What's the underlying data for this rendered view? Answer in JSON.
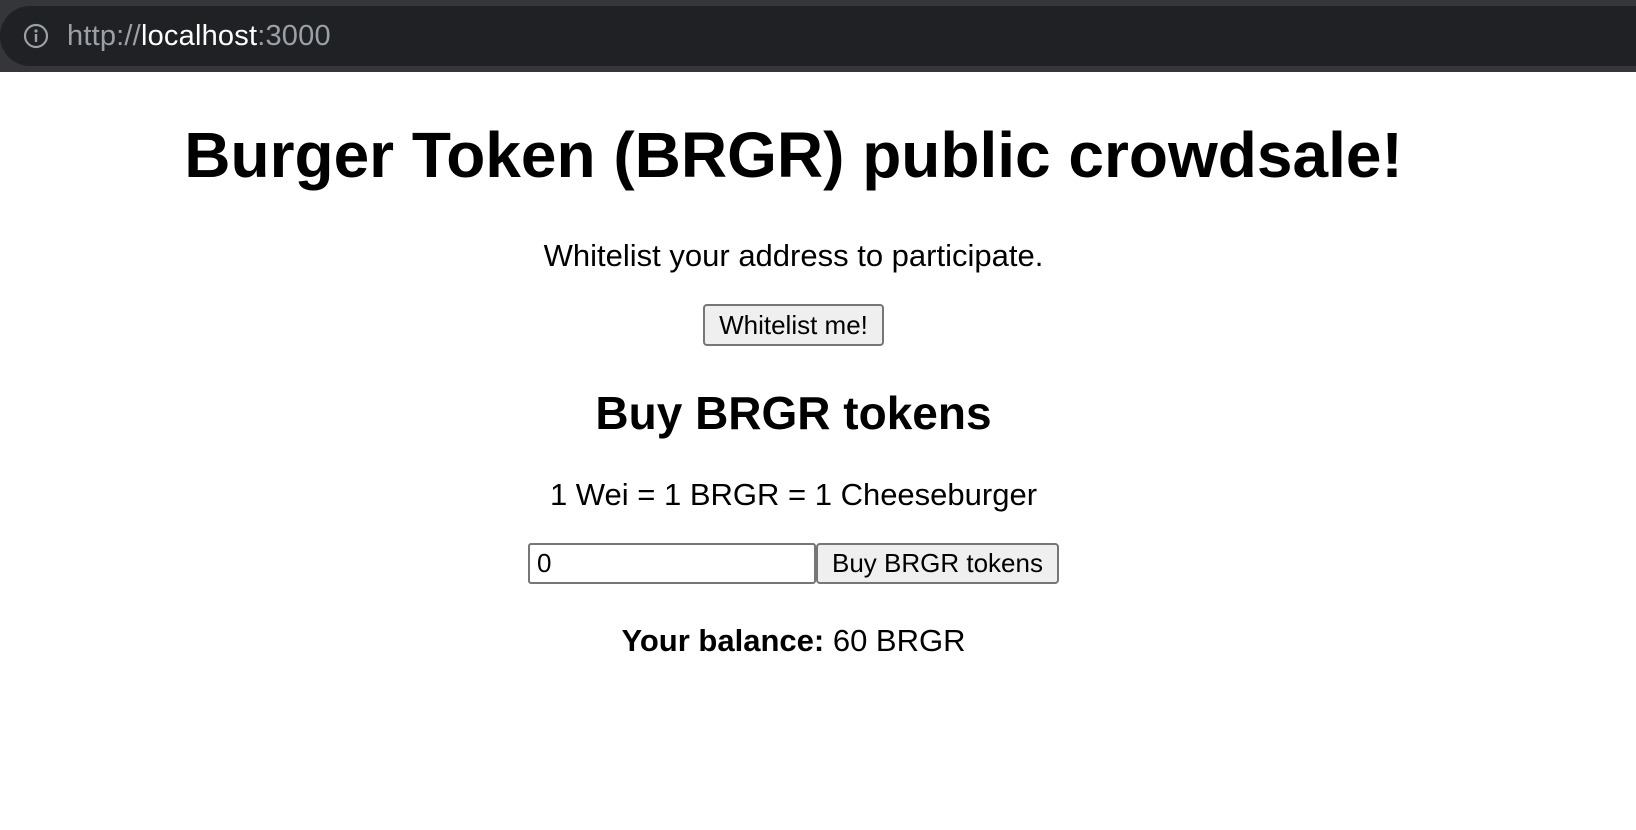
{
  "browser": {
    "url_scheme": "http://",
    "url_host": "localhost",
    "url_port": ":3000"
  },
  "page": {
    "title": "Burger Token (BRGR) public crowdsale!",
    "whitelist_prompt": "Whitelist your address to participate.",
    "whitelist_button": "Whitelist me!",
    "buy_heading": "Buy BRGR tokens",
    "rate_text": "1 Wei = 1 BRGR = 1 Cheeseburger",
    "amount_value": "0",
    "buy_button": "Buy BRGR tokens",
    "balance_label": "Your balance:",
    "balance_value": "60 BRGR"
  }
}
